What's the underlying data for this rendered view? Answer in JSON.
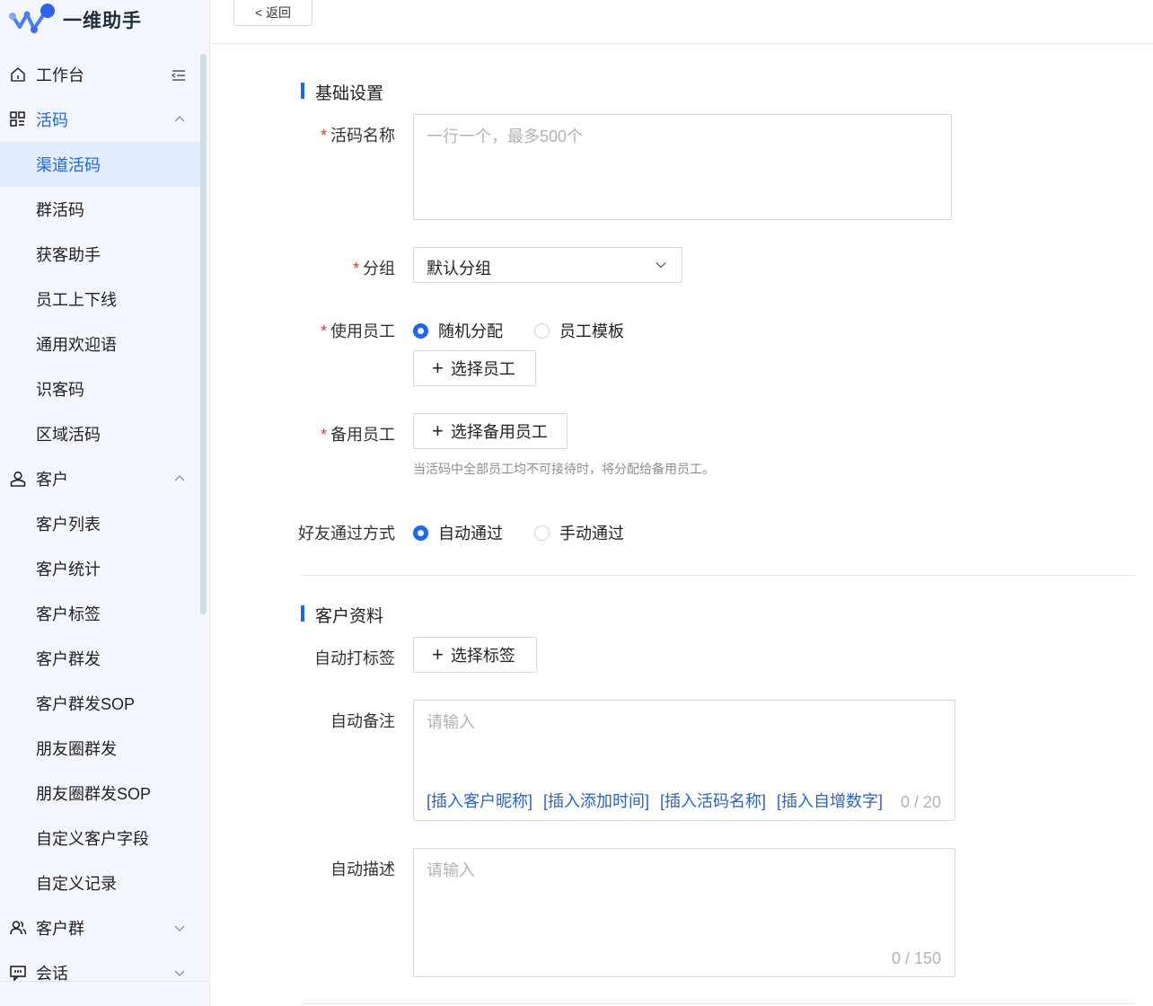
{
  "app": {
    "name": "一维助手"
  },
  "sidebar": {
    "items": [
      {
        "label": "工作台",
        "icon": "home-icon",
        "state": "normal"
      },
      {
        "label": "活码",
        "icon": "grid-icon",
        "state": "expanded-blue"
      },
      {
        "label": "渠道活码",
        "state": "selected"
      },
      {
        "label": "群活码"
      },
      {
        "label": "获客助手"
      },
      {
        "label": "员工上下线"
      },
      {
        "label": "通用欢迎语"
      },
      {
        "label": "识客码"
      },
      {
        "label": "区域活码"
      },
      {
        "label": "客户",
        "icon": "user-icon",
        "state": "expanded"
      },
      {
        "label": "客户列表"
      },
      {
        "label": "客户统计"
      },
      {
        "label": "客户标签"
      },
      {
        "label": "客户群发"
      },
      {
        "label": "客户群发SOP"
      },
      {
        "label": "朋友圈群发"
      },
      {
        "label": "朋友圈群发SOP"
      },
      {
        "label": "自定义客户字段"
      },
      {
        "label": "自定义记录"
      },
      {
        "label": "客户群",
        "icon": "users-icon",
        "state": "collapsed"
      },
      {
        "label": "会话",
        "icon": "chat-icon",
        "state": "collapsed"
      }
    ]
  },
  "topbar": {
    "back_label": "< 返回"
  },
  "form": {
    "basic_section": "基础设置",
    "code_name": {
      "label": "活码名称",
      "placeholder": "一行一个，最多500个"
    },
    "group": {
      "label": "分组",
      "value": "默认分组"
    },
    "staff": {
      "label": "使用员工",
      "option1": "随机分配",
      "option2": "员工模板",
      "button": "选择员工"
    },
    "backup_staff": {
      "label": "备用员工",
      "button": "选择备用员工",
      "hint": "当活码中全部员工均不可接待时，将分配给备用员工。"
    },
    "friend_pass": {
      "label": "好友通过方式",
      "option1": "自动通过",
      "option2": "手动通过"
    },
    "customer_section": "客户资料",
    "auto_tag": {
      "label": "自动打标签",
      "button": "选择标签"
    },
    "auto_remark": {
      "label": "自动备注",
      "placeholder": "请输入",
      "counter": "0 / 20",
      "links": [
        "[插入客户昵称]",
        "[插入添加时间]",
        "[插入活码名称]",
        "[插入自增数字]"
      ]
    },
    "auto_desc": {
      "label": "自动描述",
      "placeholder": "请输入",
      "counter": "0 / 150"
    }
  },
  "colors": {
    "accent": "#1a66ff",
    "required": "#e53935",
    "link": "#2a63c9"
  }
}
